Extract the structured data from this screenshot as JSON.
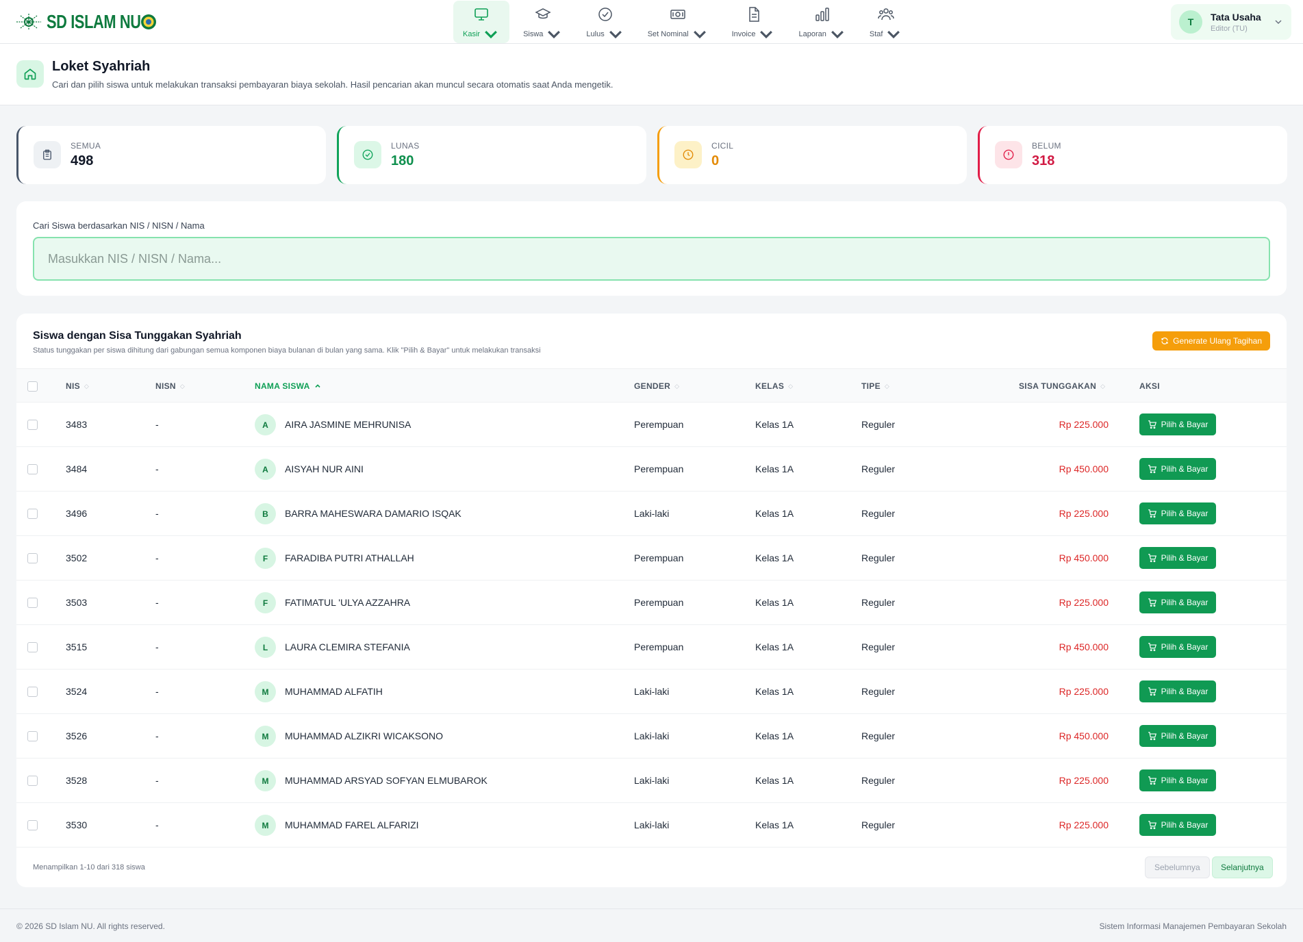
{
  "app": {
    "logo_text": "SD ISLAM NU"
  },
  "nav": [
    {
      "label": "Kasir",
      "icon": "monitor-icon",
      "active": true
    },
    {
      "label": "Siswa",
      "icon": "graduation-cap-icon"
    },
    {
      "label": "Lulus",
      "icon": "check-circle-icon"
    },
    {
      "label": "Set Nominal",
      "icon": "banknote-icon"
    },
    {
      "label": "Invoice",
      "icon": "file-text-icon"
    },
    {
      "label": "Laporan",
      "icon": "bar-chart-icon"
    },
    {
      "label": "Staf",
      "icon": "users-icon"
    }
  ],
  "user": {
    "initial": "T",
    "name": "Tata Usaha",
    "role": "Editor (TU)"
  },
  "header": {
    "title": "Loket Syahriah",
    "subtitle": "Cari dan pilih siswa untuk melakukan transaksi pembayaran biaya sekolah. Hasil pencarian akan muncul secara otomatis saat Anda mengetik."
  },
  "stats": [
    {
      "label": "SEMUA",
      "value": "498",
      "color": "#475569"
    },
    {
      "label": "LUNAS",
      "value": "180",
      "color": "#10a35a"
    },
    {
      "label": "CICIL",
      "value": "0",
      "color": "#f59e0b"
    },
    {
      "label": "BELUM",
      "value": "318",
      "color": "#e11d48"
    }
  ],
  "search": {
    "label": "Cari Siswa berdasarkan NIS / NISN / Nama",
    "placeholder": "Masukkan NIS / NISN / Nama...",
    "value": ""
  },
  "table": {
    "title": "Siswa dengan Sisa Tunggakan Syahriah",
    "subtitle": "Status tunggakan per siswa dihitung dari gabungan semua komponen biaya bulanan di bulan yang sama. Klik \"Pilih & Bayar\" untuk melakukan transaksi",
    "generate_label": "Generate Ulang Tagihan",
    "columns": {
      "nis": "NIS",
      "nisn": "NISN",
      "nama": "NAMA SISWA",
      "gender": "GENDER",
      "kelas": "KELAS",
      "tipe": "TIPE",
      "sisa": "SISA TUNGGAKAN",
      "aksi": "AKSI"
    },
    "action_label": "Pilih & Bayar",
    "rows": [
      {
        "nis": "3483",
        "nisn": "-",
        "initial": "A",
        "nama": "AIRA JASMINE MEHRUNISA",
        "gender": "Perempuan",
        "kelas": "Kelas 1A",
        "tipe": "Reguler",
        "sisa": "Rp 225.000"
      },
      {
        "nis": "3484",
        "nisn": "-",
        "initial": "A",
        "nama": "AISYAH NUR AINI",
        "gender": "Perempuan",
        "kelas": "Kelas 1A",
        "tipe": "Reguler",
        "sisa": "Rp 450.000"
      },
      {
        "nis": "3496",
        "nisn": "-",
        "initial": "B",
        "nama": "BARRA MAHESWARA DAMARIO ISQAK",
        "gender": "Laki-laki",
        "kelas": "Kelas 1A",
        "tipe": "Reguler",
        "sisa": "Rp 225.000"
      },
      {
        "nis": "3502",
        "nisn": "-",
        "initial": "F",
        "nama": "FARADIBA PUTRI ATHALLAH",
        "gender": "Perempuan",
        "kelas": "Kelas 1A",
        "tipe": "Reguler",
        "sisa": "Rp 450.000"
      },
      {
        "nis": "3503",
        "nisn": "-",
        "initial": "F",
        "nama": "FATIMATUL 'ULYA AZZAHRA",
        "gender": "Perempuan",
        "kelas": "Kelas 1A",
        "tipe": "Reguler",
        "sisa": "Rp 225.000"
      },
      {
        "nis": "3515",
        "nisn": "-",
        "initial": "L",
        "nama": "LAURA CLEMIRA STEFANIA",
        "gender": "Perempuan",
        "kelas": "Kelas 1A",
        "tipe": "Reguler",
        "sisa": "Rp 450.000"
      },
      {
        "nis": "3524",
        "nisn": "-",
        "initial": "M",
        "nama": "MUHAMMAD ALFATIH",
        "gender": "Laki-laki",
        "kelas": "Kelas 1A",
        "tipe": "Reguler",
        "sisa": "Rp 225.000"
      },
      {
        "nis": "3526",
        "nisn": "-",
        "initial": "M",
        "nama": "MUHAMMAD ALZIKRI WICAKSONO",
        "gender": "Laki-laki",
        "kelas": "Kelas 1A",
        "tipe": "Reguler",
        "sisa": "Rp 450.000"
      },
      {
        "nis": "3528",
        "nisn": "-",
        "initial": "M",
        "nama": "MUHAMMAD ARSYAD SOFYAN ELMUBAROK",
        "gender": "Laki-laki",
        "kelas": "Kelas 1A",
        "tipe": "Reguler",
        "sisa": "Rp 225.000"
      },
      {
        "nis": "3530",
        "nisn": "-",
        "initial": "M",
        "nama": "MUHAMMAD FAREL ALFARIZI",
        "gender": "Laki-laki",
        "kelas": "Kelas 1A",
        "tipe": "Reguler",
        "sisa": "Rp 225.000"
      }
    ],
    "showing": "Menampilkan 1-10 dari 318 siswa",
    "prev_label": "Sebelumnya",
    "next_label": "Selanjutnya"
  },
  "footer": {
    "copyright": "© 2026 SD Islam NU. All rights reserved.",
    "system": "Sistem Informasi Manajemen Pembayaran Sekolah"
  }
}
